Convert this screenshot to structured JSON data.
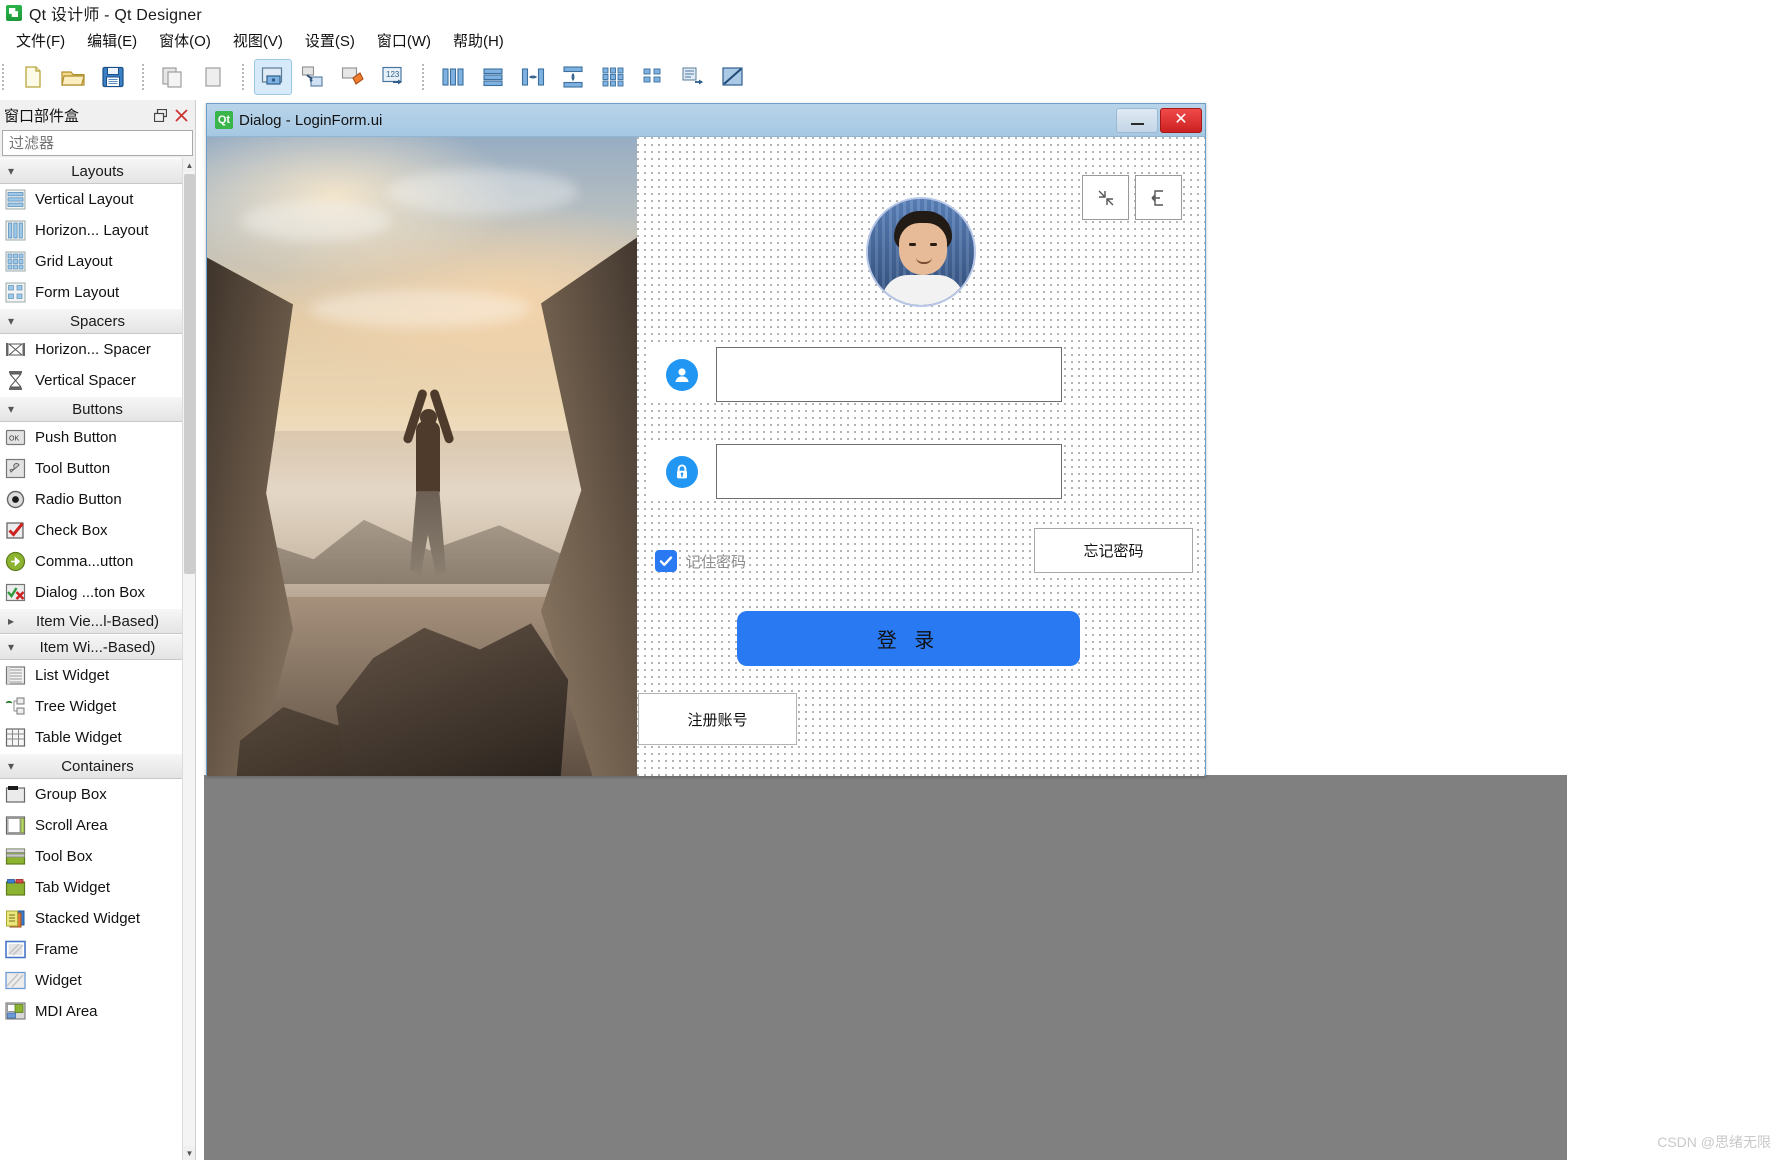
{
  "window": {
    "title": "Qt 设计师 - Qt Designer",
    "app_icon": "qt-designer-icon"
  },
  "menubar": {
    "items": [
      {
        "label": "文件(F)",
        "name": "menu-file"
      },
      {
        "label": "编辑(E)",
        "name": "menu-edit"
      },
      {
        "label": "窗体(O)",
        "name": "menu-form"
      },
      {
        "label": "视图(V)",
        "name": "menu-view"
      },
      {
        "label": "设置(S)",
        "name": "menu-settings"
      },
      {
        "label": "窗口(W)",
        "name": "menu-window"
      },
      {
        "label": "帮助(H)",
        "name": "menu-help"
      }
    ]
  },
  "toolbar": {
    "groups": [
      {
        "buttons": [
          {
            "name": "new-form-button",
            "icon": "new-file-icon"
          },
          {
            "name": "open-form-button",
            "icon": "open-folder-icon"
          },
          {
            "name": "save-form-button",
            "icon": "floppy-save-icon"
          }
        ]
      },
      {
        "buttons": [
          {
            "name": "undo-button",
            "icon": "copy-pages-icon"
          },
          {
            "name": "redo-button",
            "icon": "page-icon"
          }
        ]
      },
      {
        "buttons": [
          {
            "name": "edit-widgets-button",
            "icon": "edit-widgets-icon",
            "active": true
          },
          {
            "name": "edit-signals-slots-button",
            "icon": "signals-slots-icon"
          },
          {
            "name": "edit-buddies-button",
            "icon": "buddies-icon"
          },
          {
            "name": "edit-tab-order-button",
            "icon": "tab-order-icon"
          }
        ]
      },
      {
        "buttons": [
          {
            "name": "layout-horizontally-button",
            "icon": "layout-horizontal-icon"
          },
          {
            "name": "layout-vertically-button",
            "icon": "layout-vertical-icon"
          },
          {
            "name": "layout-splitter-horizontal-button",
            "icon": "splitter-horizontal-icon"
          },
          {
            "name": "layout-splitter-vertical-button",
            "icon": "splitter-vertical-icon"
          },
          {
            "name": "layout-grid-button",
            "icon": "layout-grid-icon"
          },
          {
            "name": "layout-form-button",
            "icon": "layout-form-icon"
          },
          {
            "name": "adjust-size-button",
            "icon": "adjust-size-icon"
          },
          {
            "name": "break-layout-button",
            "icon": "break-layout-icon"
          }
        ]
      }
    ]
  },
  "widget_box": {
    "title": "窗口部件盒",
    "float_button": "float-icon",
    "close_button": "close-icon",
    "filter_placeholder": "过滤器",
    "filter_value": "",
    "sections": [
      {
        "name": "layouts",
        "title": "Layouts",
        "expanded": true,
        "arrow": "chevron-down-icon",
        "items": [
          {
            "label": "Vertical Layout",
            "icon": "vertical-layout-icon"
          },
          {
            "label": "Horizon... Layout",
            "icon": "horizontal-layout-icon"
          },
          {
            "label": "Grid Layout",
            "icon": "grid-layout-icon"
          },
          {
            "label": "Form Layout",
            "icon": "form-layout-icon"
          }
        ]
      },
      {
        "name": "spacers",
        "title": "Spacers",
        "expanded": true,
        "arrow": "chevron-down-icon",
        "items": [
          {
            "label": "Horizon... Spacer",
            "icon": "horizontal-spacer-icon"
          },
          {
            "label": "Vertical Spacer",
            "icon": "vertical-spacer-icon"
          }
        ]
      },
      {
        "name": "buttons",
        "title": "Buttons",
        "expanded": true,
        "arrow": "chevron-down-icon",
        "items": [
          {
            "label": "Push Button",
            "icon": "push-button-icon"
          },
          {
            "label": "Tool Button",
            "icon": "tool-button-icon"
          },
          {
            "label": "Radio Button",
            "icon": "radio-button-icon"
          },
          {
            "label": "Check Box",
            "icon": "check-box-icon"
          },
          {
            "label": "Comma...utton",
            "icon": "command-link-button-icon"
          },
          {
            "label": "Dialog ...ton Box",
            "icon": "dialog-button-box-icon"
          }
        ]
      },
      {
        "name": "item-views",
        "title": "Item Vie...l-Based)",
        "expanded": false,
        "arrow": "chevron-right-icon",
        "items": []
      },
      {
        "name": "item-widgets",
        "title": "Item Wi...-Based)",
        "expanded": true,
        "arrow": "chevron-down-icon",
        "items": [
          {
            "label": "List Widget",
            "icon": "list-widget-icon"
          },
          {
            "label": "Tree Widget",
            "icon": "tree-widget-icon"
          },
          {
            "label": "Table Widget",
            "icon": "table-widget-icon"
          }
        ]
      },
      {
        "name": "containers",
        "title": "Containers",
        "expanded": true,
        "arrow": "chevron-down-icon",
        "items": [
          {
            "label": "Group Box",
            "icon": "group-box-icon"
          },
          {
            "label": "Scroll Area",
            "icon": "scroll-area-icon"
          },
          {
            "label": "Tool Box",
            "icon": "tool-box-icon"
          },
          {
            "label": "Tab Widget",
            "icon": "tab-widget-icon"
          },
          {
            "label": "Stacked Widget",
            "icon": "stacked-widget-icon"
          },
          {
            "label": "Frame",
            "icon": "frame-icon"
          },
          {
            "label": "Widget",
            "icon": "widget-icon"
          },
          {
            "label": "MDI Area",
            "icon": "mdi-area-icon"
          }
        ]
      }
    ]
  },
  "dialog": {
    "badge": "Qt",
    "title": "Dialog - LoginForm.ui",
    "minimize_label": "minimize-icon",
    "close_label": "✕",
    "preview_image_alt": "mountain-sunrise-photo",
    "avatar_alt": "user-avatar-photo",
    "corner_buttons": [
      {
        "name": "minimize-widget-button",
        "icon": "collapse-arrows-icon"
      },
      {
        "name": "exit-widget-button",
        "icon": "exit-door-icon"
      }
    ],
    "username_field": {
      "icon": "user-icon",
      "value": "",
      "placeholder": ""
    },
    "password_field": {
      "icon": "lock-icon",
      "value": "",
      "placeholder": ""
    },
    "remember": {
      "checked": true,
      "label": "记住密码"
    },
    "forgot_button": "忘记密码",
    "login_button": "登 录",
    "register_button": "注册账号",
    "accent_color": "#2979f2"
  },
  "watermark": "CSDN @思绪无限"
}
